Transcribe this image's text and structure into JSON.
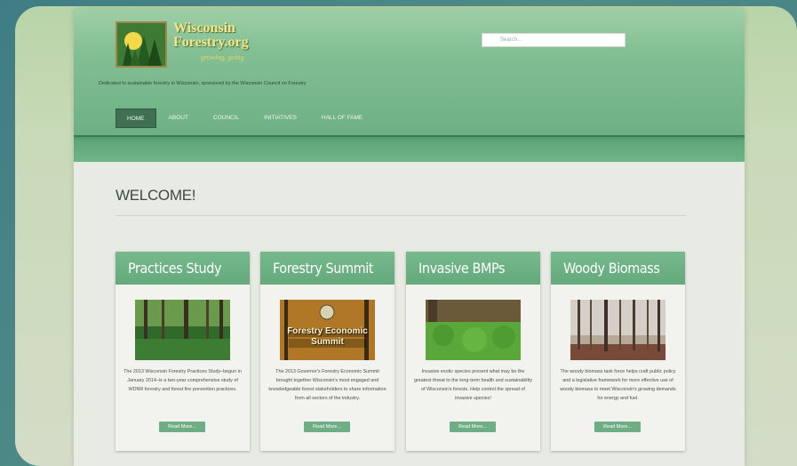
{
  "site": {
    "logo_line1": "Wisconsin",
    "logo_line2": "Forestry.org",
    "logo_tag": "growing, going",
    "tagline": "Dedicated to sustainable forestry in Wisconsin, sponsored by the Wisconsin Council on Forestry",
    "search_placeholder": "Search..."
  },
  "nav": [
    "HOME",
    "ABOUT",
    "COUNCIL",
    "INITIATIVES",
    "HALL OF FAME"
  ],
  "welcome": "WELCOME!",
  "cards": [
    {
      "title": "Practices Study",
      "text": "The 2013 Wisconsin Forestry Practices Study–begun in January 2014–is a two-year comprehensive study of WDNR forestry and forest fire prevention practices.",
      "button": "Read More..."
    },
    {
      "title": "Forestry Summit",
      "image_text": "Forestry Economic Summit",
      "text": "The 2013 Governor's Forestry Economic Summit brought together Wisconsin's most engaged and knowledgeable forest stakeholders to share information from all sectors of the industry.",
      "button": "Read More..."
    },
    {
      "title": "Invasive BMPs",
      "text": "Invasive exotic species present what may be the greatest threat to the long-term health and sustainability of Wisconsin's forests. Help control the spread of invasive species!",
      "button": "Read More..."
    },
    {
      "title": "Woody Biomass",
      "text": "The woody biomass task force helps craft public policy and a legislative framework for more effective use of woody biomass to meet Wisconsin's growing demands for energy and fuel.",
      "button": "Read More..."
    }
  ],
  "colors": {
    "header": "#7dbb90",
    "accent": "#6fae84",
    "nav_active": "#3f7054"
  }
}
